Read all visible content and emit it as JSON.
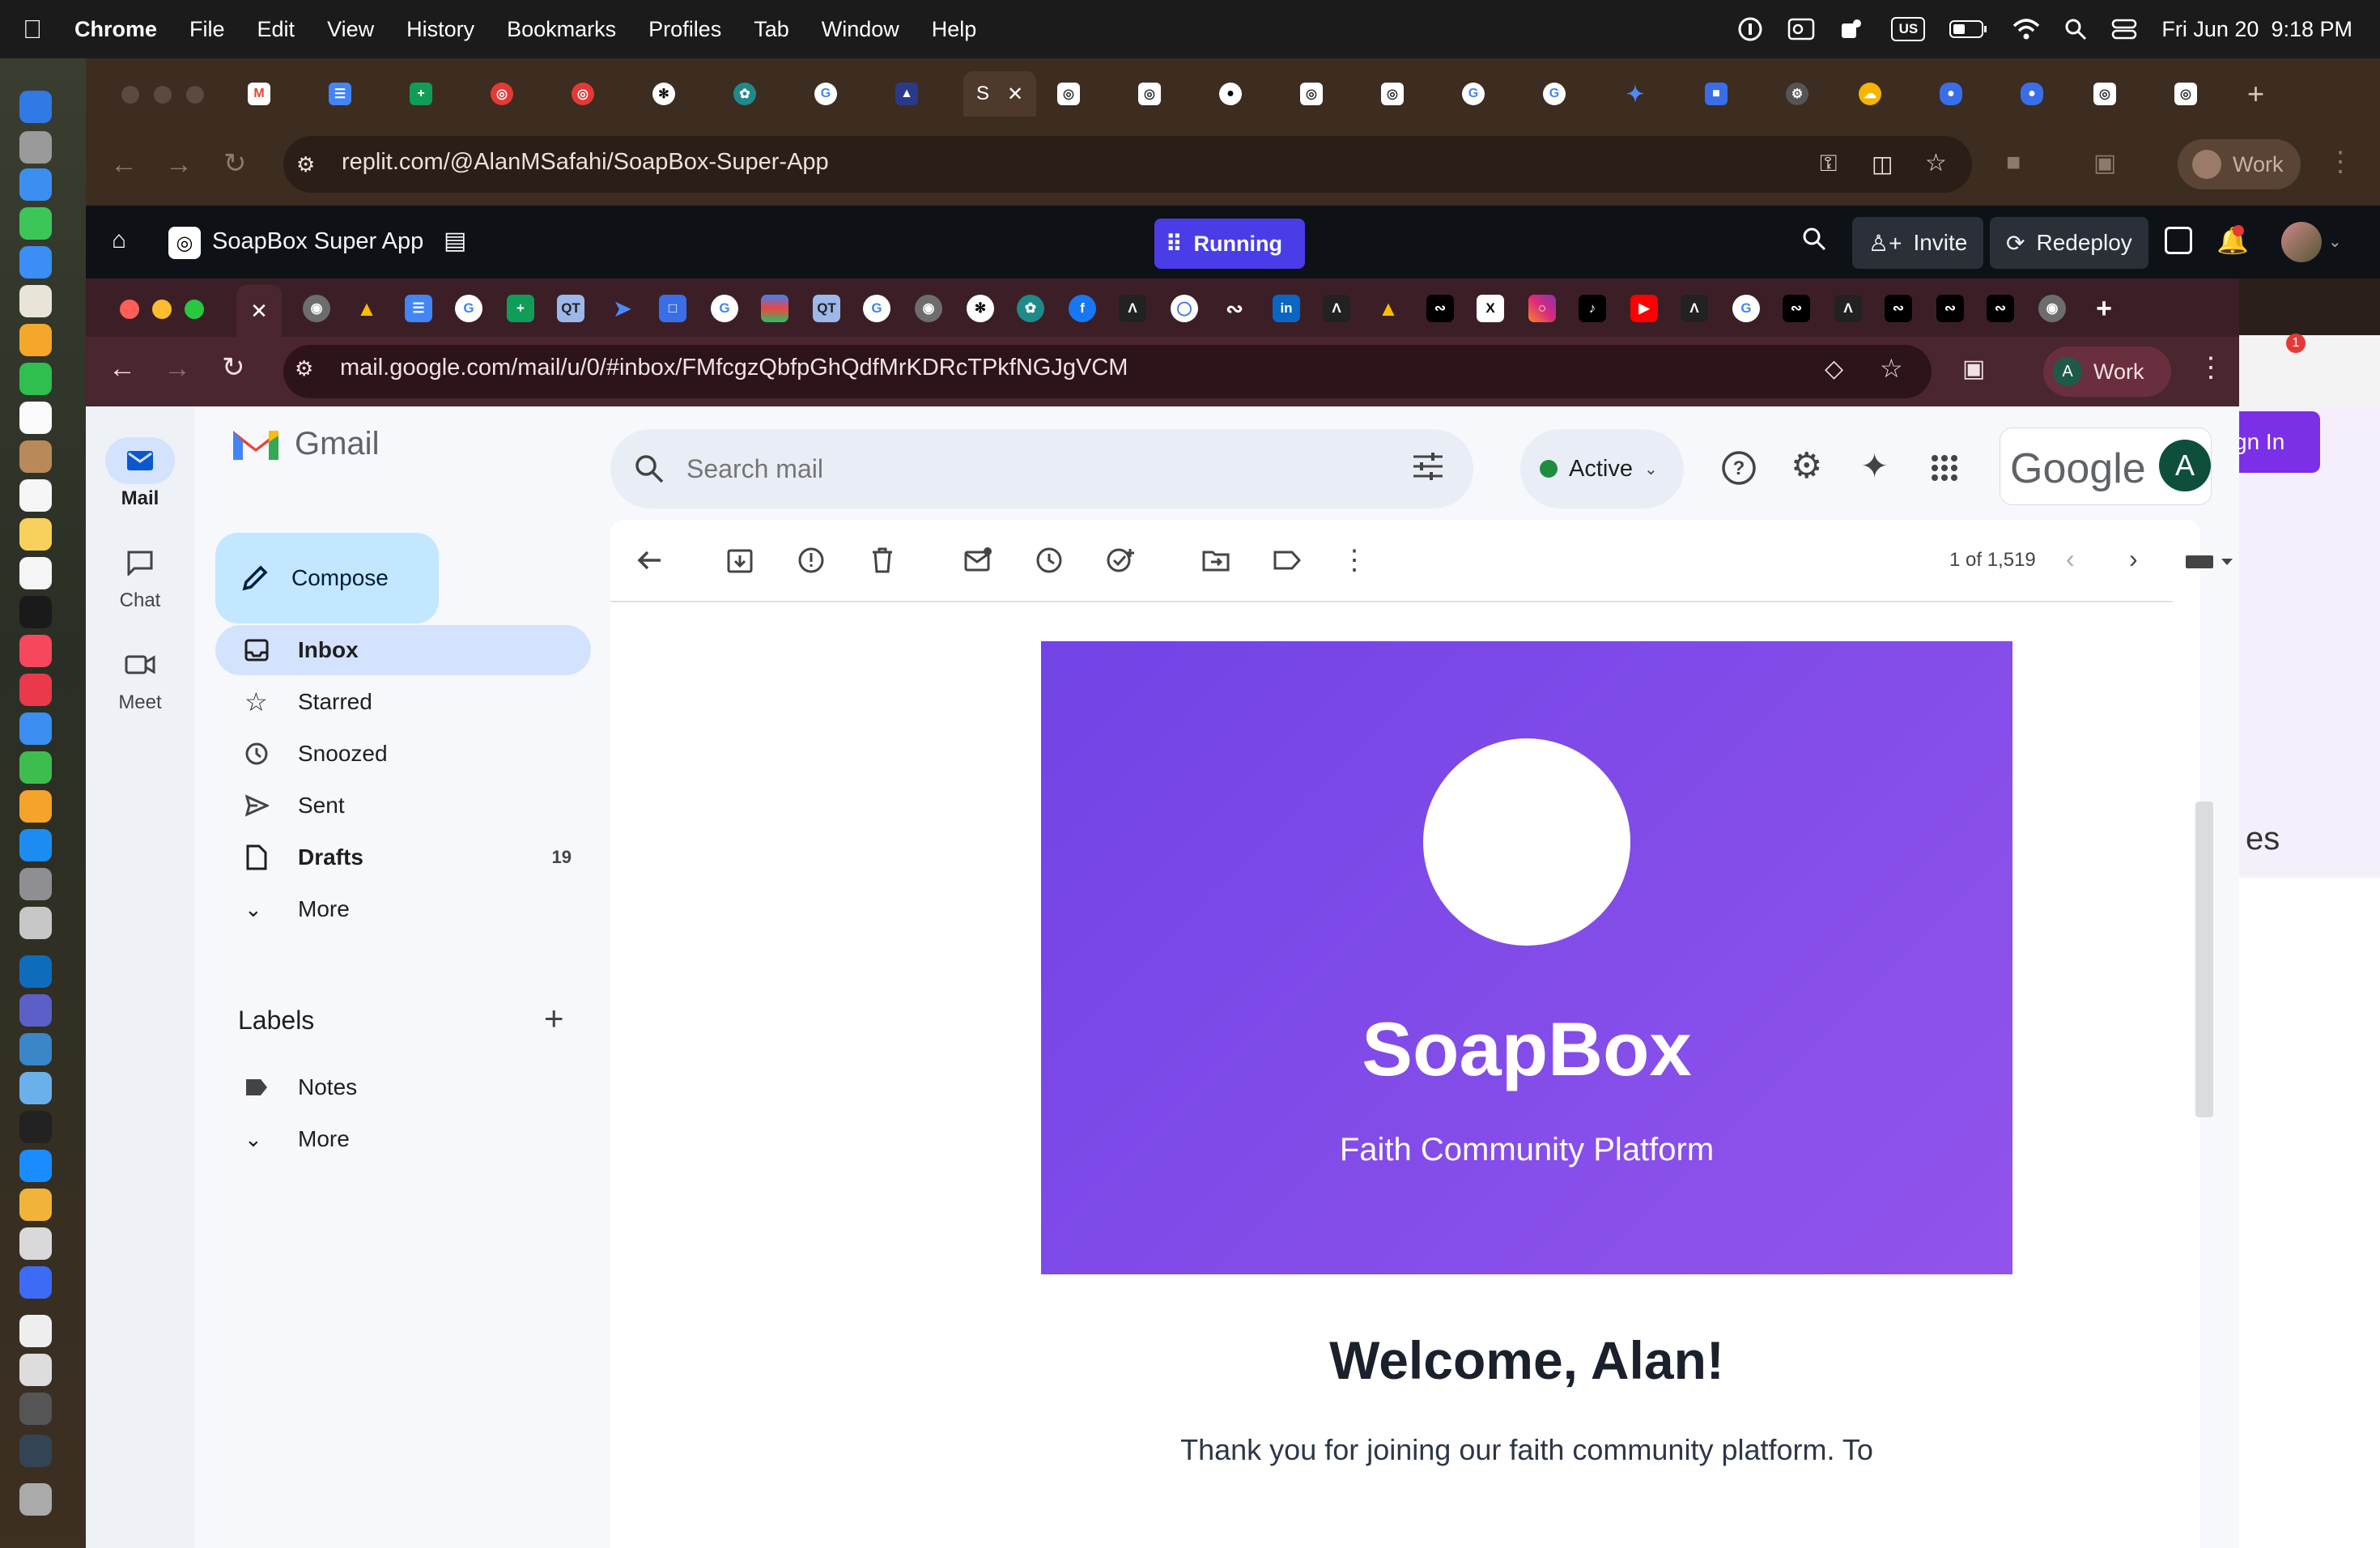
{
  "menubar": {
    "app": "Chrome",
    "items": [
      "File",
      "Edit",
      "View",
      "History",
      "Bookmarks",
      "Profiles",
      "Tab",
      "Window",
      "Help"
    ],
    "kbd_layout": "US",
    "datetime": "Fri Jun 20  9:18 PM"
  },
  "outer_browser": {
    "url": "replit.com/@AlanMSafahi/SoapBox-Super-App",
    "profile": "Work",
    "active_tab_letter": "S"
  },
  "replit": {
    "app_title": "SoapBox Super App",
    "status": "Running",
    "invite": "Invite",
    "redeploy": "Redeploy"
  },
  "background_page": {
    "sign_in_partial": "gn In",
    "partial_text": "es",
    "badge_count": "1"
  },
  "inner_browser": {
    "url": "mail.google.com/mail/u/0/#inbox/FMfcgzQbfpGhQdfMrKDRcTPkfNGJgVCM",
    "profile_initial": "A",
    "profile": "Work"
  },
  "gmail": {
    "logo_text": "Gmail",
    "search_placeholder": "Search mail",
    "status": "Active",
    "google_wordmark": "Google",
    "avatar_initial": "A",
    "rail": {
      "mail": "Mail",
      "chat": "Chat",
      "meet": "Meet"
    },
    "compose": "Compose",
    "nav": {
      "inbox": "Inbox",
      "starred": "Starred",
      "snoozed": "Snoozed",
      "sent": "Sent",
      "drafts": "Drafts",
      "drafts_count": "19",
      "more": "More"
    },
    "labels_heading": "Labels",
    "labels": {
      "notes": "Notes",
      "more": "More"
    },
    "pagination": "1 of 1,519"
  },
  "email": {
    "brand": "SoapBox",
    "tagline": "Faith Community Platform",
    "greeting": "Welcome, Alan!",
    "body_start": "Thank you for joining our faith community platform. To"
  },
  "colors": {
    "banner": "#7b46e8",
    "running": "#4a3de8",
    "compose_bg": "#c2e7ff",
    "active_dot": "#1e8e3e"
  }
}
